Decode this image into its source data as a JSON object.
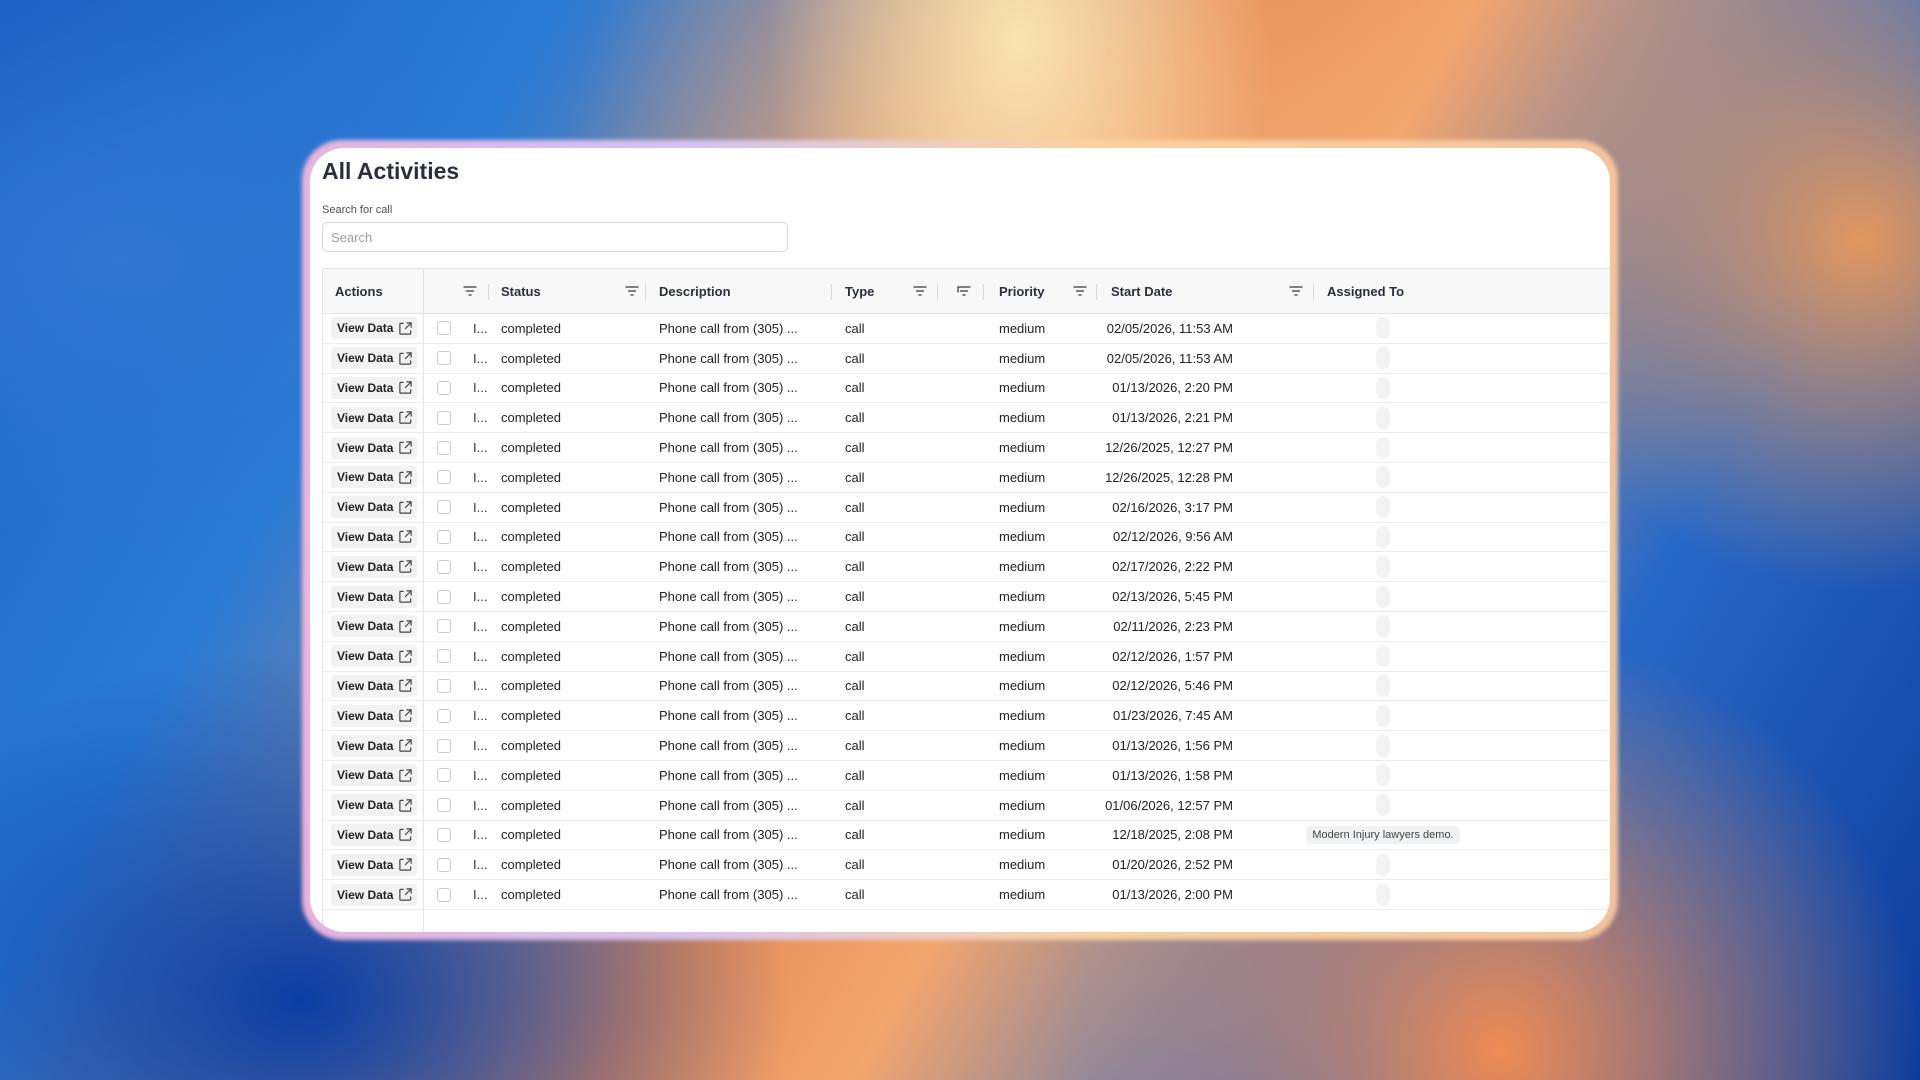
{
  "page": {
    "title": "All Activities"
  },
  "search": {
    "label": "Search for call",
    "placeholder": "Search",
    "value": ""
  },
  "columns": {
    "actions": "Actions",
    "status": "Status",
    "description": "Description",
    "type": "Type",
    "priority": "Priority",
    "start_date": "Start Date",
    "assigned_to": "Assigned To"
  },
  "view_label": "View Data",
  "rows": [
    {
      "id": "I...",
      "status": "completed",
      "description": "Phone call from (305) ...",
      "type": "call",
      "priority": "medium",
      "start_date": "02/05/2026, 11:53 AM",
      "assigned": ""
    },
    {
      "id": "I...",
      "status": "completed",
      "description": "Phone call from (305) ...",
      "type": "call",
      "priority": "medium",
      "start_date": "02/05/2026, 11:53 AM",
      "assigned": ""
    },
    {
      "id": "I...",
      "status": "completed",
      "description": "Phone call from (305) ...",
      "type": "call",
      "priority": "medium",
      "start_date": "01/13/2026, 2:20 PM",
      "assigned": ""
    },
    {
      "id": "I...",
      "status": "completed",
      "description": "Phone call from (305) ...",
      "type": "call",
      "priority": "medium",
      "start_date": "01/13/2026, 2:21 PM",
      "assigned": ""
    },
    {
      "id": "I...",
      "status": "completed",
      "description": "Phone call from (305) ...",
      "type": "call",
      "priority": "medium",
      "start_date": "12/26/2025, 12:27 PM",
      "assigned": ""
    },
    {
      "id": "I...",
      "status": "completed",
      "description": "Phone call from (305) ...",
      "type": "call",
      "priority": "medium",
      "start_date": "12/26/2025, 12:28 PM",
      "assigned": ""
    },
    {
      "id": "I...",
      "status": "completed",
      "description": "Phone call from (305) ...",
      "type": "call",
      "priority": "medium",
      "start_date": "02/16/2026, 3:17 PM",
      "assigned": ""
    },
    {
      "id": "I...",
      "status": "completed",
      "description": "Phone call from (305) ...",
      "type": "call",
      "priority": "medium",
      "start_date": "02/12/2026, 9:56 AM",
      "assigned": ""
    },
    {
      "id": "I...",
      "status": "completed",
      "description": "Phone call from (305) ...",
      "type": "call",
      "priority": "medium",
      "start_date": "02/17/2026, 2:22 PM",
      "assigned": ""
    },
    {
      "id": "I...",
      "status": "completed",
      "description": "Phone call from (305) ...",
      "type": "call",
      "priority": "medium",
      "start_date": "02/13/2026, 5:45 PM",
      "assigned": ""
    },
    {
      "id": "I...",
      "status": "completed",
      "description": "Phone call from (305) ...",
      "type": "call",
      "priority": "medium",
      "start_date": "02/11/2026, 2:23 PM",
      "assigned": ""
    },
    {
      "id": "I...",
      "status": "completed",
      "description": "Phone call from (305) ...",
      "type": "call",
      "priority": "medium",
      "start_date": "02/12/2026, 1:57 PM",
      "assigned": ""
    },
    {
      "id": "I...",
      "status": "completed",
      "description": "Phone call from (305) ...",
      "type": "call",
      "priority": "medium",
      "start_date": "02/12/2026, 5:46 PM",
      "assigned": ""
    },
    {
      "id": "I...",
      "status": "completed",
      "description": "Phone call from (305) ...",
      "type": "call",
      "priority": "medium",
      "start_date": "01/23/2026, 7:45 AM",
      "assigned": ""
    },
    {
      "id": "I...",
      "status": "completed",
      "description": "Phone call from (305) ...",
      "type": "call",
      "priority": "medium",
      "start_date": "01/13/2026, 1:56 PM",
      "assigned": ""
    },
    {
      "id": "I...",
      "status": "completed",
      "description": "Phone call from (305) ...",
      "type": "call",
      "priority": "medium",
      "start_date": "01/13/2026, 1:58 PM",
      "assigned": ""
    },
    {
      "id": "I...",
      "status": "completed",
      "description": "Phone call from (305) ...",
      "type": "call",
      "priority": "medium",
      "start_date": "01/06/2026, 12:57 PM",
      "assigned": ""
    },
    {
      "id": "I...",
      "status": "completed",
      "description": "Phone call from (305) ...",
      "type": "call",
      "priority": "medium",
      "start_date": "12/18/2025, 2:08 PM",
      "assigned": "Modern Injury lawyers demo."
    },
    {
      "id": "I...",
      "status": "completed",
      "description": "Phone call from (305) ...",
      "type": "call",
      "priority": "medium",
      "start_date": "01/20/2026, 2:52 PM",
      "assigned": ""
    },
    {
      "id": "I...",
      "status": "completed",
      "description": "Phone call from (305) ...",
      "type": "call",
      "priority": "medium",
      "start_date": "01/13/2026, 2:00 PM",
      "assigned": ""
    }
  ]
}
